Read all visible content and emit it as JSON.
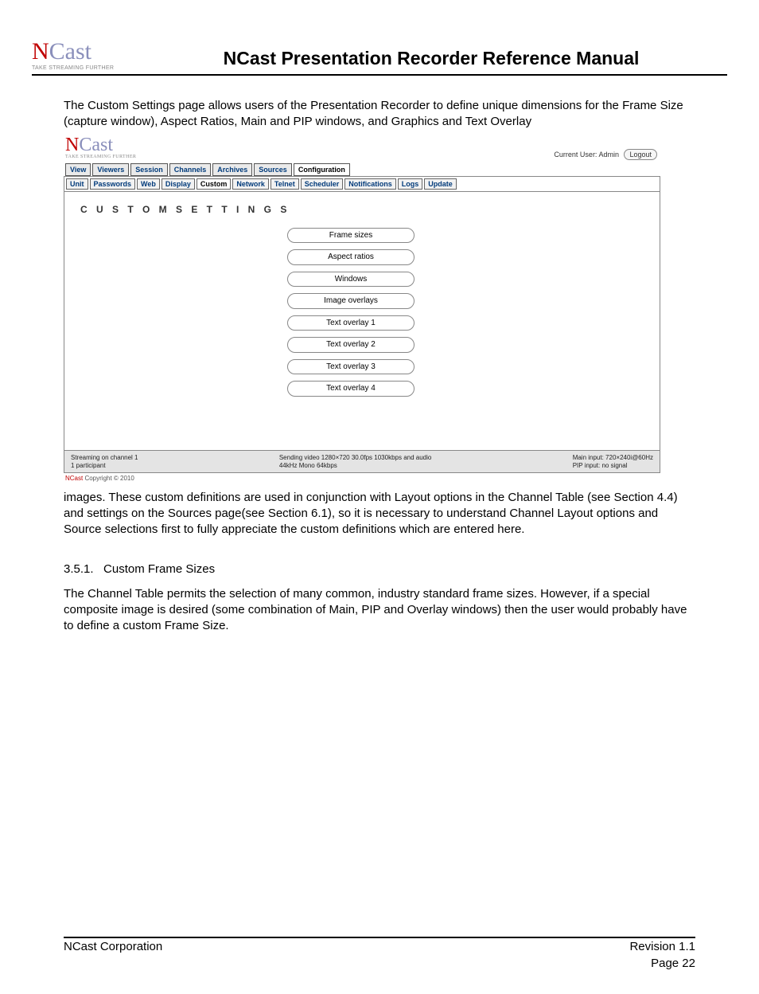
{
  "doc": {
    "logo_text_n": "N",
    "logo_text_cast": "Cast",
    "logo_tagline": "TAKE STREAMING FURTHER",
    "title": "NCast Presentation Recorder Reference Manual",
    "intro_para": "The Custom Settings page allows users of the Presentation Recorder to define unique dimensions for the Frame Size (capture window), Aspect Ratios, Main and PIP windows, and Graphics and Text Overlay",
    "after_para": "images. These custom definitions are used in conjunction with Layout options in the Channel Table (see Section 4.4) and settings on the Sources page(see Section 6.1), so it is necessary to understand Channel Layout options and Source selections first to fully appreciate the custom definitions which are entered here.",
    "section_number": "3.5.1.",
    "section_title": "Custom Frame Sizes",
    "section_body": "The Channel Table permits the selection of many common, industry standard frame sizes. However, if a special composite image is desired (some combination of Main, PIP and Overlay windows) then the user would probably have to define a custom Frame Size.",
    "footer_left": "NCast Corporation",
    "footer_right": "Revision 1.1",
    "page_number": "Page 22"
  },
  "app": {
    "logo_n": "N",
    "logo_cast": "Cast",
    "logo_tagline": "TAKE STREAMING FURTHER",
    "current_user_label": "Current User: Admin",
    "logout_label": "Logout",
    "tabs": [
      "View",
      "Viewers",
      "Session",
      "Channels",
      "Archives",
      "Sources",
      "Configuration"
    ],
    "active_tab": "Configuration",
    "subtabs": [
      "Unit",
      "Passwords",
      "Web",
      "Display",
      "Custom",
      "Network",
      "Telnet",
      "Scheduler",
      "Notifications",
      "Logs",
      "Update"
    ],
    "active_subtab": "Custom",
    "panel_title": "CUSTOM SETTINGS",
    "buttons": [
      "Frame sizes",
      "Aspect ratios",
      "Windows",
      "Image overlays",
      "Text overlay 1",
      "Text overlay 2",
      "Text overlay 3",
      "Text overlay 4"
    ],
    "status_left": "Streaming on channel 1\n1 participant",
    "status_mid": "Sending video 1280×720 30.0fps 1030kbps and audio\n44kHz Mono 64kbps",
    "status_right": "Main input: 720×240i@60Hz\nPIP input: no signal",
    "copyright_prefix": "NCast",
    "copyright_rest": " Copyright © 2010"
  }
}
